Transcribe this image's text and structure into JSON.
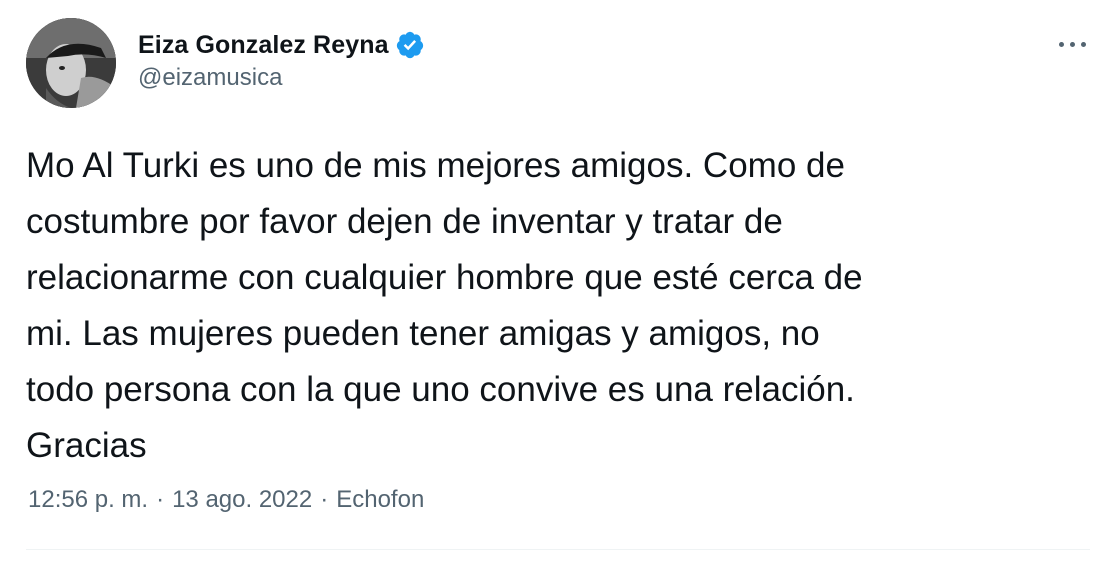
{
  "author": {
    "display_name": "Eiza Gonzalez Reyna",
    "handle": "@eizamusica",
    "verified": true
  },
  "tweet": {
    "text": "Mo Al Turki es uno de mis mejores amigos. Como de\ncostumbre por favor dejen de inventar y tratar de\nrelacionarme con cualquier hombre que esté cerca de\nmi. Las mujeres pueden tener amigas y amigos, no\ntodo persona con la que uno convive es una relación.\nGracias",
    "time": "12:56 p. m.",
    "separator": "·",
    "date": "13 ago. 2022",
    "source": "Echofon"
  },
  "icons": {
    "verified": "verified-badge-icon",
    "more": "more-options-icon"
  },
  "colors": {
    "verified_blue": "#1d9bf0",
    "secondary_text": "#536471",
    "primary_text": "#0f1419",
    "divider": "#eff3f4"
  }
}
